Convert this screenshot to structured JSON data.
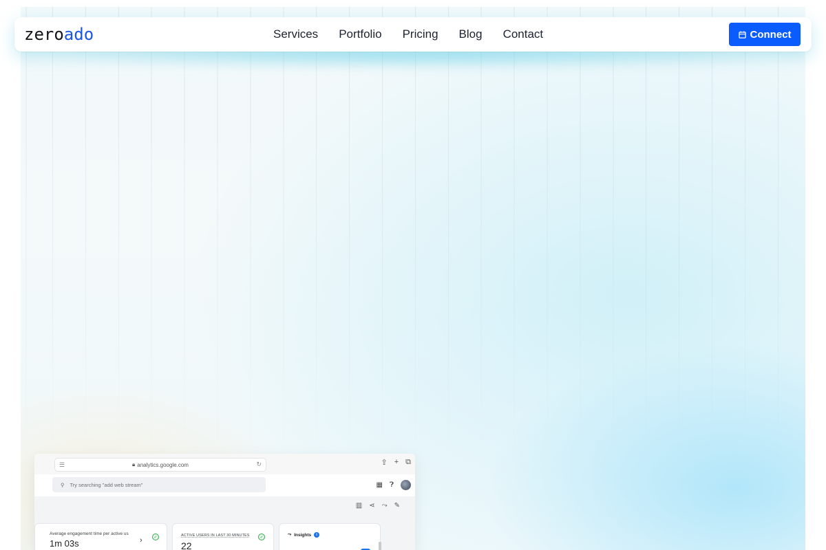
{
  "logo": {
    "part1": "zero",
    "part2": "ado"
  },
  "nav": {
    "links": [
      "Services",
      "Portfolio",
      "Pricing",
      "Blog",
      "Contact"
    ],
    "cta_label": "Connect",
    "cta_icon": "calendar-icon"
  },
  "colors": {
    "brand_blue": "#0b5cff",
    "logo_blue": "#1a56e8",
    "text_dark": "#1c2230"
  },
  "browser": {
    "url": "analytics.google.com",
    "search_placeholder": "Try searching \"add web stream\"",
    "cards": [
      {
        "label": "Average engagement time per active us",
        "value": "1m 03s"
      },
      {
        "label": "ACTIVE USERS IN LAST 30 MINUTES",
        "value": "22"
      },
      {
        "label": "Insights"
      }
    ]
  }
}
